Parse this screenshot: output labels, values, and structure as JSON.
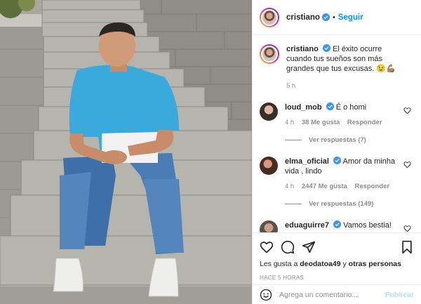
{
  "post": {
    "photo_alt": "man sitting on stone steps"
  },
  "header": {
    "username": "cristiano",
    "separator": "•",
    "follow_label": "Seguir"
  },
  "caption": {
    "username": "cristiano",
    "text": "El éxito ocurre cuando tus sueños son más grandes que tus excusas. 😉💪🏽",
    "time": "5 h"
  },
  "comments": [
    {
      "username": "loud_mob",
      "verified": true,
      "text": "É o homi",
      "time": "4 h",
      "likes": "38 Me gusta",
      "reply_label": "Responder",
      "view_replies": "Ver respuestas (7)"
    },
    {
      "username": "elma_oficial",
      "verified": true,
      "text": "Amor da minha vida , lindo",
      "time": "4 h",
      "likes": "2447 Me gusta",
      "reply_label": "Responder",
      "view_replies": "Ver respuestas (149)"
    },
    {
      "username": "eduaguirre7",
      "verified": true,
      "text": "Vamos bestia!",
      "time": "",
      "likes": "",
      "reply_label": "",
      "view_replies": ""
    }
  ],
  "likes_prefix": "Les gusta a ",
  "likes_user": "deodatoa49",
  "likes_connector": " y ",
  "likes_others": "otras personas",
  "posted_ago": "HACE 5 HORAS",
  "add_comment": {
    "placeholder": "Agrega un comentario...",
    "publish_label": "Publicar"
  },
  "colors": {
    "accent": "#0095f6",
    "verified": "#3897f0",
    "publish_disabled": "#b2dffc",
    "secondary_text": "#8e8e8e"
  },
  "icons": [
    "verified-badge-icon",
    "heart-icon",
    "comment-icon",
    "share-icon",
    "bookmark-icon",
    "emoji-icon"
  ]
}
